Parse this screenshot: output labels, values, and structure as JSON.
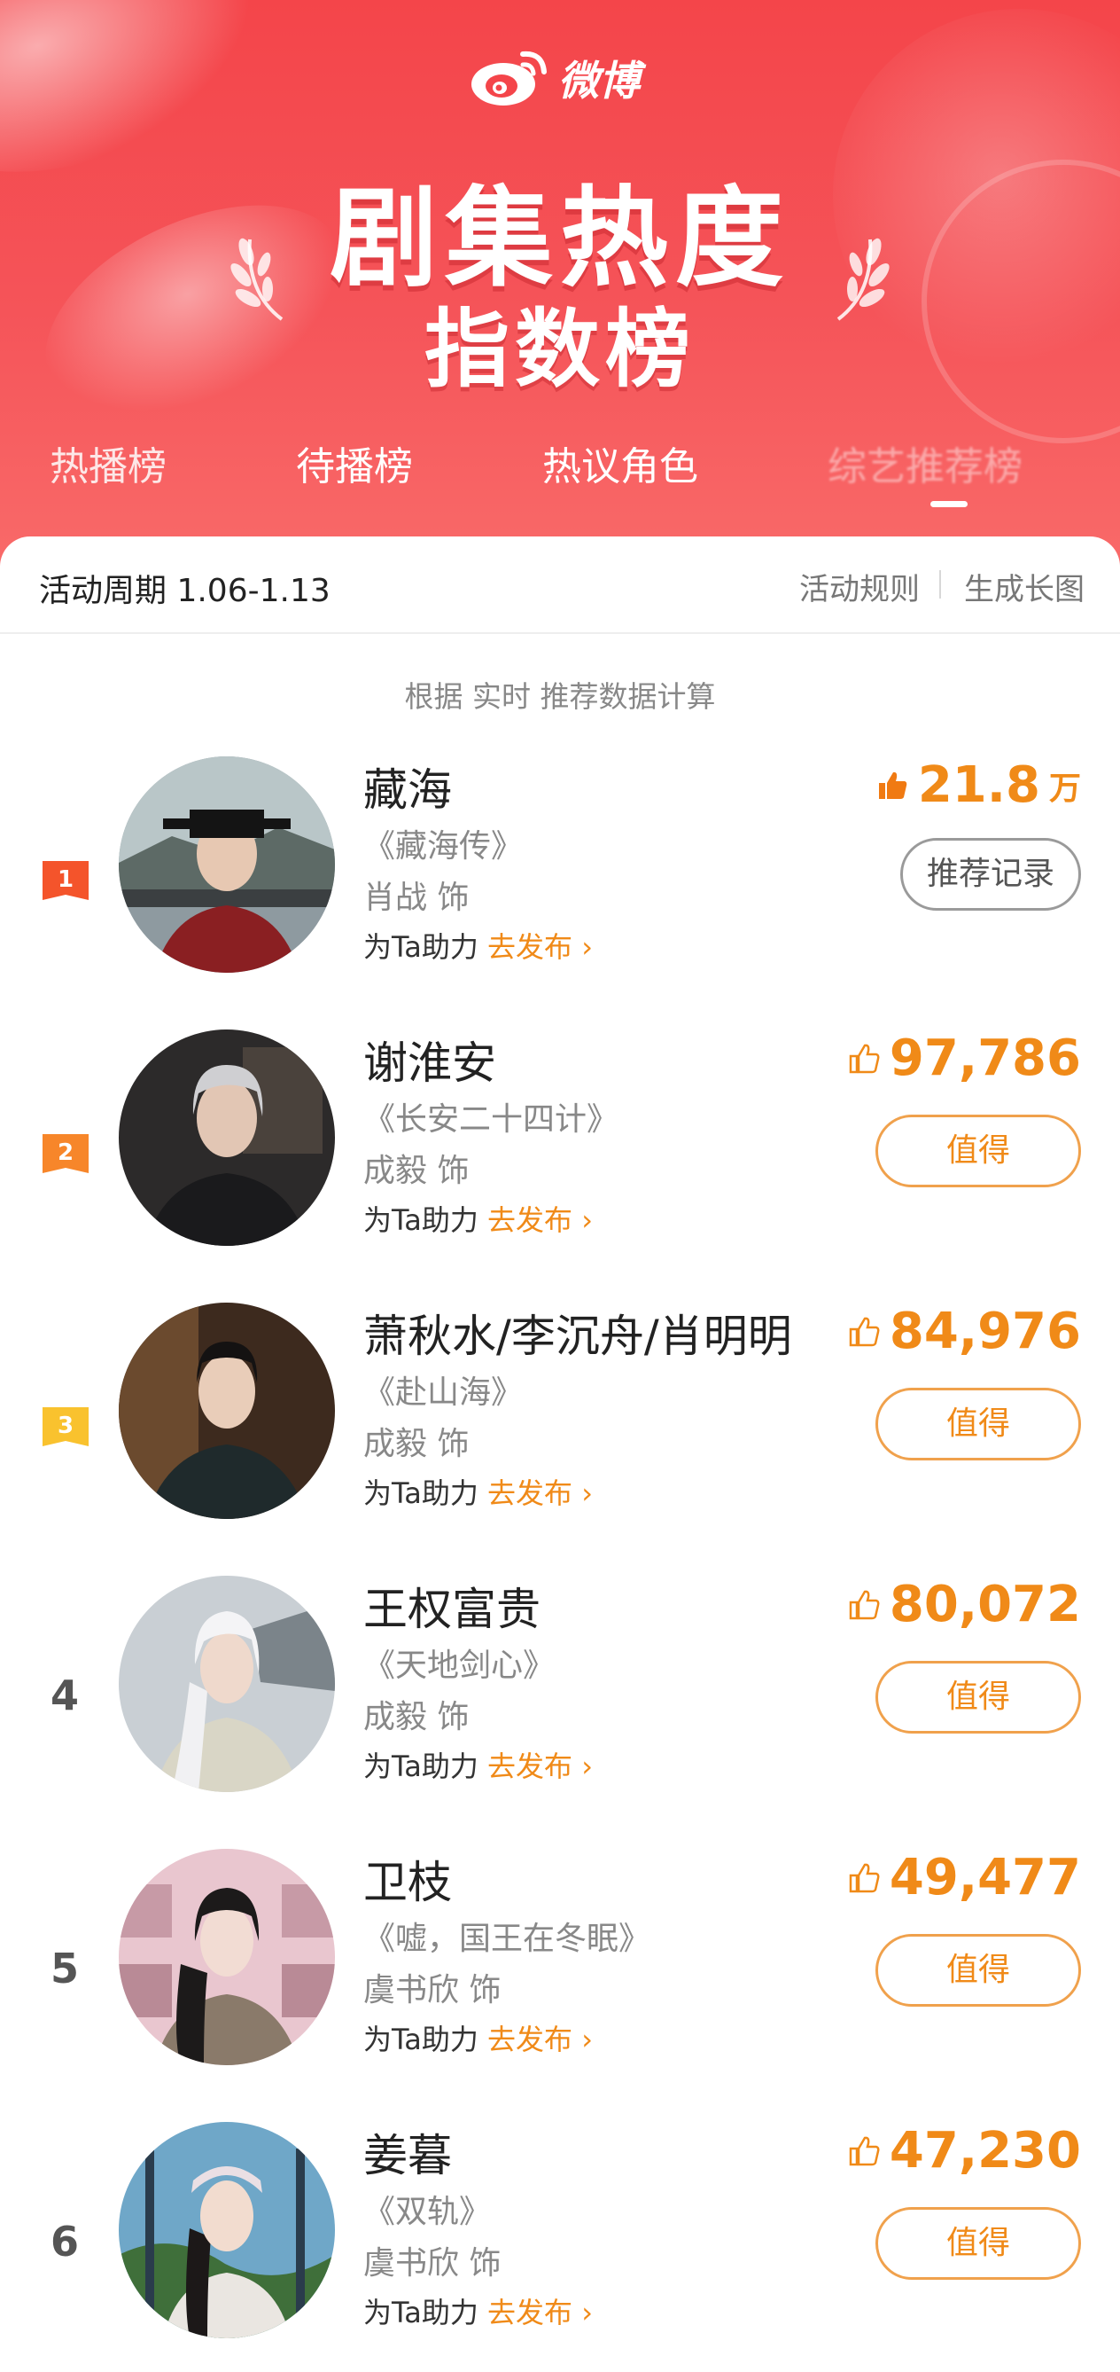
{
  "header": {
    "logo_text": "微博",
    "title_main": "剧集热度",
    "title_sub": "指数榜",
    "tabs": [
      {
        "label": "热播榜"
      },
      {
        "label": "待播榜"
      },
      {
        "label": "热议角色"
      },
      {
        "label": "综艺推荐榜"
      }
    ],
    "active_tab_index": 3
  },
  "period": {
    "label": "活动周期 1.06-1.13",
    "rules_link": "活动规则",
    "image_link": "生成长图"
  },
  "note": "根据 实时 推荐数据计算",
  "ranking": [
    {
      "rank": "1",
      "badge_color": "#f4542b",
      "name": "藏海",
      "drama": "《藏海传》",
      "actor": "肖战 饰",
      "boost_prefix": "为Ta助力",
      "boost_link": "去发布 ›",
      "score": "21.8",
      "score_unit": "万",
      "button": "推荐记录",
      "liked": true
    },
    {
      "rank": "2",
      "badge_color": "#f7862a",
      "name": "谢淮安",
      "drama": "《长安二十四计》",
      "actor": "成毅 饰",
      "boost_prefix": "为Ta助力",
      "boost_link": "去发布 ›",
      "score": "97,786",
      "score_unit": "",
      "button": "值得",
      "liked": false
    },
    {
      "rank": "3",
      "badge_color": "#f9c22e",
      "name": "萧秋水/李沉舟/肖明明",
      "drama": "《赴山海》",
      "actor": "成毅 饰",
      "boost_prefix": "为Ta助力",
      "boost_link": "去发布 ›",
      "score": "84,976",
      "score_unit": "",
      "button": "值得",
      "liked": false
    },
    {
      "rank": "4",
      "badge_color": "",
      "name": "王权富贵",
      "drama": "《天地剑心》",
      "actor": "成毅 饰",
      "boost_prefix": "为Ta助力",
      "boost_link": "去发布 ›",
      "score": "80,072",
      "score_unit": "",
      "button": "值得",
      "liked": false
    },
    {
      "rank": "5",
      "badge_color": "",
      "name": "卫枝",
      "drama": "《嘘，国王在冬眠》",
      "actor": "虞书欣 饰",
      "boost_prefix": "为Ta助力",
      "boost_link": "去发布 ›",
      "score": "49,477",
      "score_unit": "",
      "button": "值得",
      "liked": false
    },
    {
      "rank": "6",
      "badge_color": "",
      "name": "姜暮",
      "drama": "《双轨》",
      "actor": "虞书欣 饰",
      "boost_prefix": "为Ta助力",
      "boost_link": "去发布 ›",
      "score": "47,230",
      "score_unit": "",
      "button": "值得",
      "liked": false
    }
  ],
  "colors": {
    "accent_orange": "#f08a18",
    "banner_red": "#f4454a"
  },
  "icons": {
    "logo": "weibo-eye-icon",
    "thumb_filled": "thumbs-up-filled-icon",
    "thumb_outline": "thumbs-up-outline-icon",
    "rank_badge": "rank-ribbon-icon"
  }
}
